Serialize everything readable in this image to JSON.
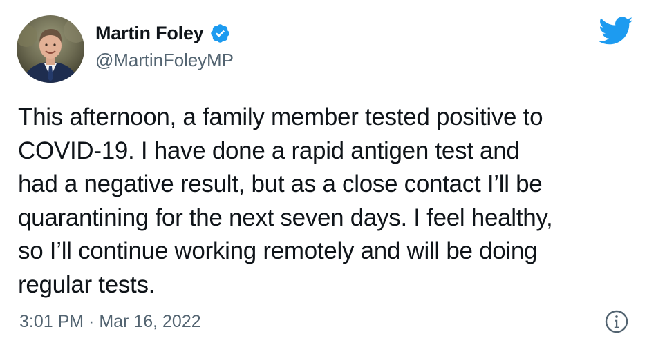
{
  "author": {
    "display_name": "Martin Foley",
    "handle": "@MartinFoleyMP",
    "verified": true
  },
  "tweet": {
    "text": "This afternoon, a family member tested positive to\nCOVID-19. I have done a rapid antigen test and\nhad a negative result, but as a close contact I’ll be\nquarantining for the next seven days. I feel healthy,\nso I’ll continue working remotely and will be doing\nregular tests.",
    "timestamp": "3:01 PM · Mar 16, 2022"
  },
  "icons": {
    "brand": "twitter-bird-icon",
    "verified": "verified-badge-icon",
    "info": "info-icon"
  },
  "colors": {
    "twitter_blue": "#1d9bf0",
    "secondary_text": "#536471",
    "primary_text": "#0f1419"
  }
}
